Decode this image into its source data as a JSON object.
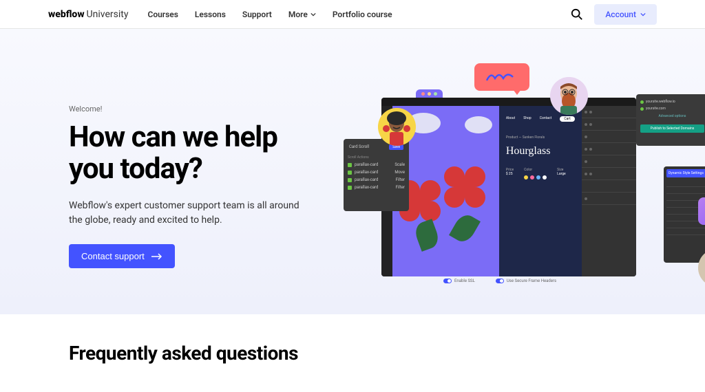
{
  "nav": {
    "logo_bold": "webflow",
    "logo_light": "University",
    "links": [
      "Courses",
      "Lessons",
      "Support"
    ],
    "more_label": "More",
    "portfolio_label": "Portfolio course",
    "account_label": "Account"
  },
  "hero": {
    "eyebrow": "Welcome!",
    "title": "How can we help you today?",
    "description": "Webflow's expert customer support team is all around the globe, ready and excited to help.",
    "cta_label": "Contact support"
  },
  "designer": {
    "hourglass_label": "Hourglass",
    "product_label": "Product — Sunken Florals",
    "interactions_title": "Card Scroll",
    "interactions_sub": "Scroll Actions",
    "interactions_save": "Save",
    "publish_domain1": "yoursite.webflow.io",
    "publish_domain2": "yoursite.com",
    "publish_advanced": "Advanced options",
    "publish_btn": "Publish to Selected Domains",
    "style_header": "Dynamic Style Settings",
    "toggle1": "Enable SSL",
    "toggle2": "Use Secure Frame Headers"
  },
  "bubble_question": "?",
  "faq": {
    "title": "Frequently asked questions"
  }
}
